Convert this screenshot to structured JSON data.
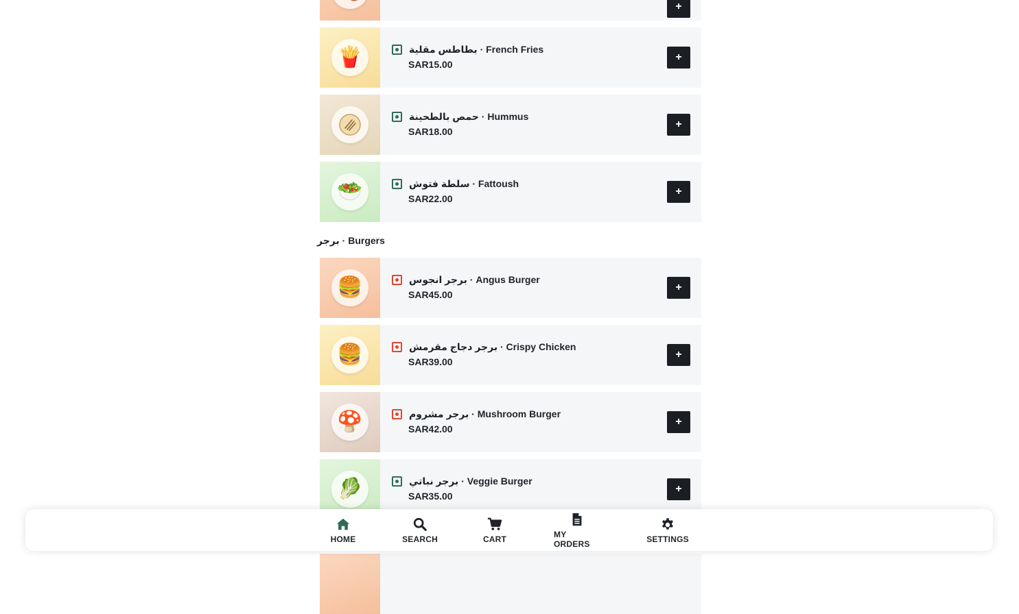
{
  "sections": [
    {
      "title": "",
      "items": [
        {
          "name": "",
          "price": "",
          "veg": false,
          "icon": "food-icon",
          "bg": "#f9cfb3"
        },
        {
          "name": "بطاطس مقلية · French Fries",
          "price": "SAR15.00",
          "veg": true,
          "icon": "fries-icon",
          "bg": "#fbe8b0"
        },
        {
          "name": "حمص بالطحينة · Hummus",
          "price": "SAR18.00",
          "veg": true,
          "icon": "hummus-icon",
          "bg": "#ede0c8"
        },
        {
          "name": "سلطة فتوش · Fattoush",
          "price": "SAR22.00",
          "veg": true,
          "icon": "salad-icon",
          "bg": "#d6f0cf"
        }
      ]
    },
    {
      "title": "برجر · Burgers",
      "items": [
        {
          "name": "برجر انجوس · Angus Burger",
          "price": "SAR45.00",
          "veg": false,
          "icon": "burger-icon",
          "bg": "#f9cfb3"
        },
        {
          "name": "برجر دجاج مقرمش · Crispy Chicken",
          "price": "SAR39.00",
          "veg": false,
          "icon": "burger-icon",
          "bg": "#fbe8b0"
        },
        {
          "name": "برجر مشروم · Mushroom Burger",
          "price": "SAR42.00",
          "veg": false,
          "icon": "mushroom-icon",
          "bg": "#ede0d6"
        },
        {
          "name": "برجر نباتي · Veggie Burger",
          "price": "SAR35.00",
          "veg": true,
          "icon": "leafy-green-icon",
          "bg": "#d6f0cf"
        }
      ]
    }
  ],
  "add_label": "+",
  "nav": [
    {
      "label": "HOME",
      "icon": "home-icon",
      "active": true
    },
    {
      "label": "SEARCH",
      "icon": "search-icon",
      "active": false
    },
    {
      "label": "CART",
      "icon": "cart-icon",
      "active": false
    },
    {
      "label": "MY ORDERS",
      "icon": "document-icon",
      "active": false
    },
    {
      "label": "SETTINGS",
      "icon": "gear-icon",
      "active": false
    }
  ],
  "colors": {
    "accent": "#2f6b55",
    "nonveg": "#e2462f",
    "button": "#1b1e22",
    "card_bg": "#f5f6f8"
  }
}
